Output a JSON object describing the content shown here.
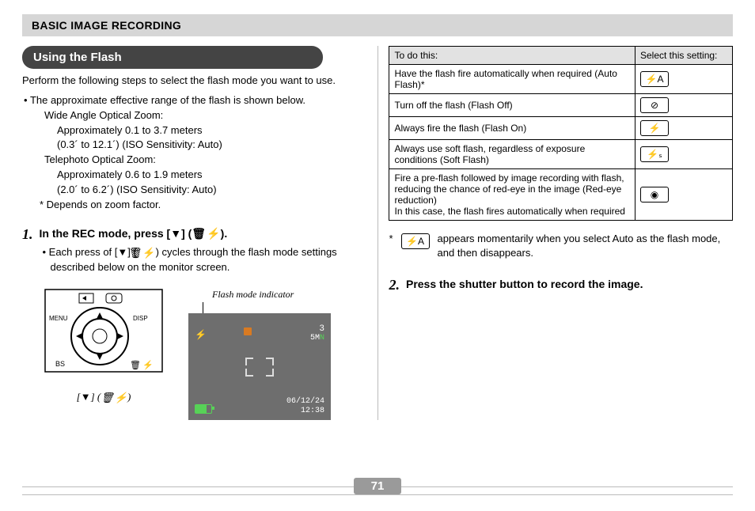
{
  "page_number": "71",
  "header": "BASIC IMAGE RECORDING",
  "section_title": "Using the Flash",
  "intro": "Perform the following steps to select the flash mode you want to use.",
  "range_bullet": "The approximate effective range of the flash is shown below.",
  "range": {
    "wide_label": "Wide Angle Optical Zoom:",
    "wide_line1": "Approximately 0.1 to 3.7 meters",
    "wide_line2": "(0.3´ to 12.1´) (ISO Sensitivity: Auto)",
    "tele_label": "Telephoto Optical Zoom:",
    "tele_line1": "Approximately 0.6 to 1.9 meters",
    "tele_line2": "(2.0´ to 6.2´) (ISO Sensitivity: Auto)",
    "depends": "Depends on zoom factor."
  },
  "step1": {
    "num": "1.",
    "pre": "In the REC mode, press [",
    "mid": "] (",
    "post": ").",
    "sub_pre": "Each press of [",
    "sub_mid": "] (",
    "sub_post": ") cycles through the flash mode settings described below on the monitor screen."
  },
  "camera": {
    "menu_label": "MENU",
    "disp_label": "DISP",
    "bs_label": "BS",
    "caption_pre": "[",
    "caption_mid": "] (",
    "caption_post": ")"
  },
  "lcd": {
    "caption": "Flash mode indicator",
    "count": "3",
    "res_num": "5",
    "res_m": "M",
    "res_n": "N",
    "date": "06/12/24",
    "time": "12:38"
  },
  "table": {
    "head_left": "To do this:",
    "head_right": "Select this setting:",
    "rows": [
      {
        "desc": "Have the flash fire automatically when required (Auto Flash)*",
        "icon": "flash-auto-icon",
        "glyph": "⚡A"
      },
      {
        "desc": "Turn off the flash (Flash Off)",
        "icon": "flash-off-icon",
        "glyph": "⊘"
      },
      {
        "desc": "Always fire the flash (Flash On)",
        "icon": "flash-on-icon",
        "glyph": "⚡"
      },
      {
        "desc": "Always use soft flash, regardless of exposure conditions (Soft Flash)",
        "icon": "flash-soft-icon",
        "glyph": "⚡ₛ"
      },
      {
        "desc": "Fire a pre-flash followed by image recording with flash, reducing the chance of red-eye in the image (Red-eye reduction)\nIn this case, the flash fires automatically when required",
        "icon": "red-eye-icon",
        "glyph": "◉"
      }
    ]
  },
  "note_star": "*",
  "note_glyph": "⚡A",
  "note_text": "appears momentarily when you select Auto as the flash mode, and then disappears.",
  "step2": {
    "num": "2.",
    "text": "Press the shutter button to record the image."
  }
}
